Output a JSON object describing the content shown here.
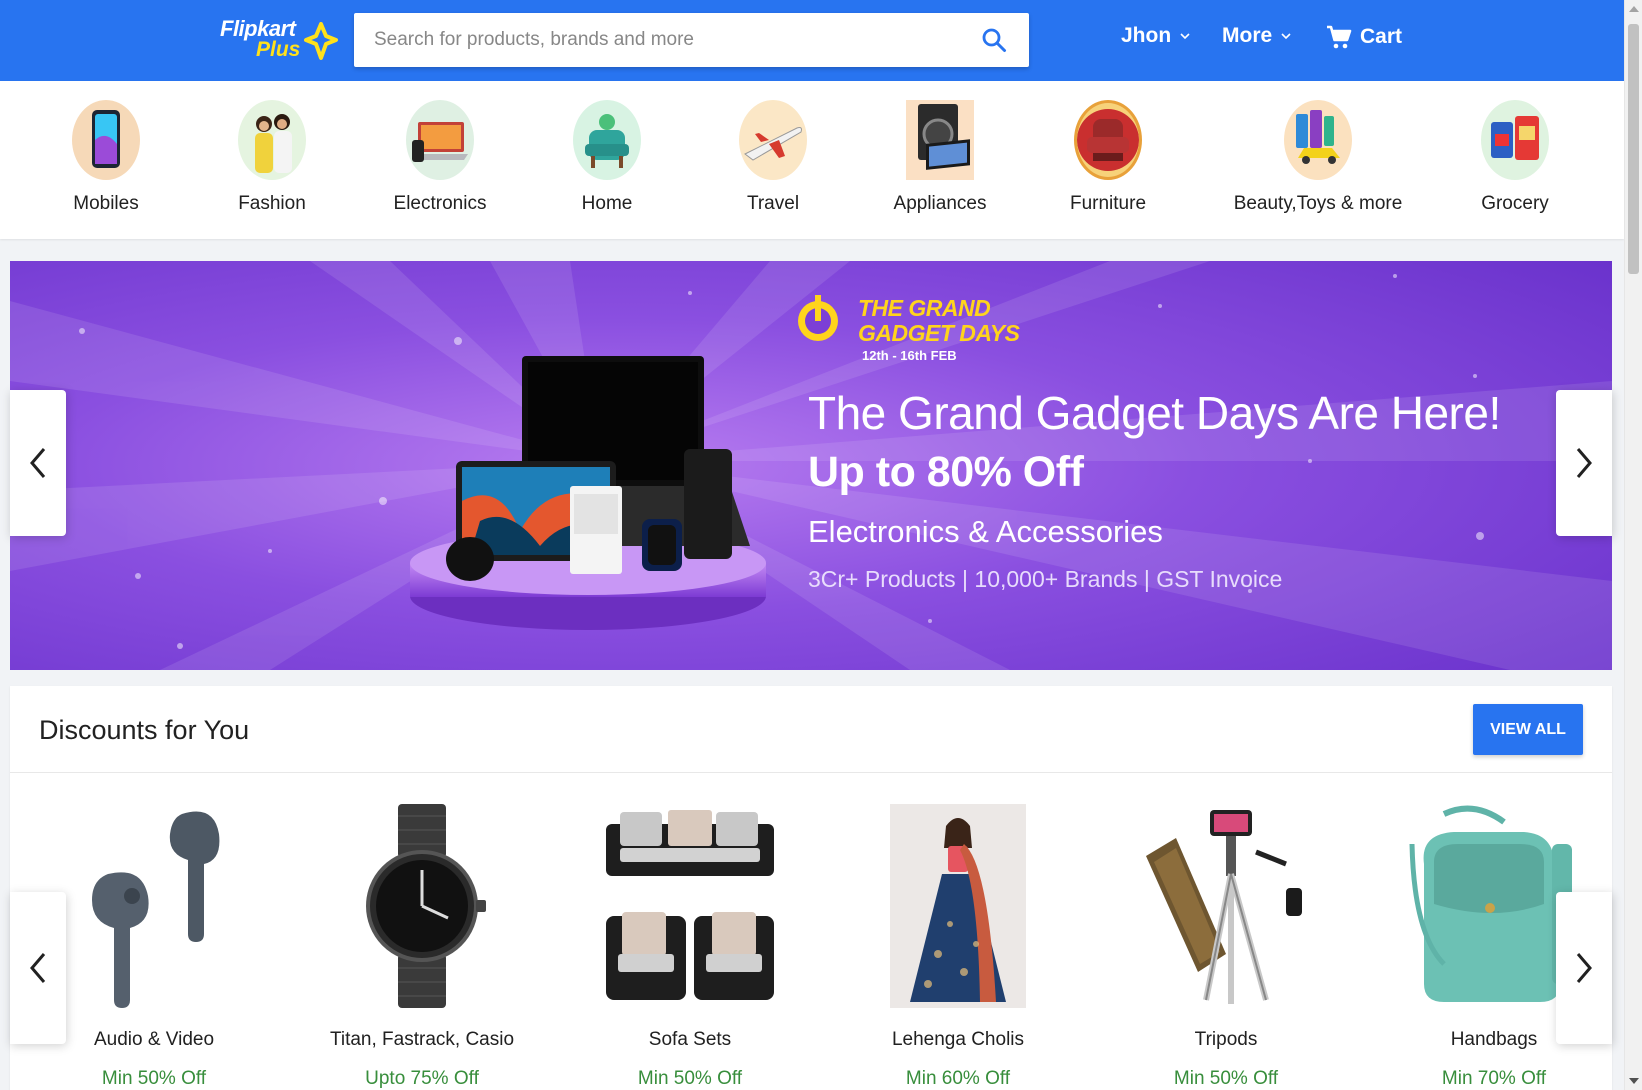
{
  "header": {
    "logo_main": "Flipkart",
    "logo_sub": "Plus",
    "search_placeholder": "Search for products, brands and more",
    "search_icon": "search-icon",
    "user_label": "Jhon",
    "more_label": "More",
    "cart_label": "Cart",
    "brand_color": "#2874f0"
  },
  "categories": [
    {
      "label": "Mobiles",
      "icon": "mobile-icon"
    },
    {
      "label": "Fashion",
      "icon": "fashion-icon"
    },
    {
      "label": "Electronics",
      "icon": "laptop-icon"
    },
    {
      "label": "Home",
      "icon": "home-icon"
    },
    {
      "label": "Travel",
      "icon": "plane-icon"
    },
    {
      "label": "Appliances",
      "icon": "appliance-icon"
    },
    {
      "label": "Furniture",
      "icon": "furniture-icon"
    },
    {
      "label": "Beauty,Toys & more",
      "icon": "toys-icon"
    },
    {
      "label": "Grocery",
      "icon": "grocery-icon"
    }
  ],
  "banner": {
    "sale_name_line1": "THE GRAND",
    "sale_name_line2": "GADGET DAYS",
    "sale_dates": "12th - 16th FEB",
    "headline": "The Grand Gadget Days Are Here!",
    "offer": "Up to 80% Off",
    "category": "Electronics & Accessories",
    "meta": "3Cr+ Products | 10,000+ Brands | GST Invoice",
    "bg_color": "#7c3fd6"
  },
  "deals": {
    "title": "Discounts for You",
    "view_all": "VIEW ALL",
    "items": [
      {
        "name": "Audio & Video",
        "discount": "Min 50% Off"
      },
      {
        "name": "Titan, Fastrack, Casio",
        "discount": "Upto 75% Off"
      },
      {
        "name": "Sofa Sets",
        "discount": "Min 50% Off"
      },
      {
        "name": "Lehenga Cholis",
        "discount": "Min 60% Off"
      },
      {
        "name": "Tripods",
        "discount": "Min 50% Off"
      },
      {
        "name": "Handbags",
        "discount": "Min 70% Off"
      }
    ],
    "discount_color": "#388e3c"
  }
}
